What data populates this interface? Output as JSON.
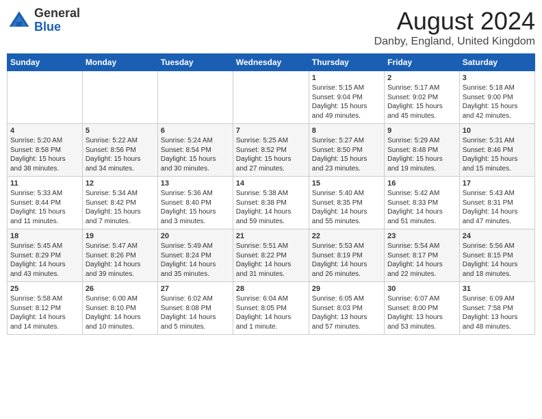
{
  "logo": {
    "general": "General",
    "blue": "Blue"
  },
  "header": {
    "month_year": "August 2024",
    "location": "Danby, England, United Kingdom"
  },
  "days_of_week": [
    "Sunday",
    "Monday",
    "Tuesday",
    "Wednesday",
    "Thursday",
    "Friday",
    "Saturday"
  ],
  "weeks": [
    [
      {
        "day": "",
        "info": ""
      },
      {
        "day": "",
        "info": ""
      },
      {
        "day": "",
        "info": ""
      },
      {
        "day": "",
        "info": ""
      },
      {
        "day": "1",
        "info": "Sunrise: 5:15 AM\nSunset: 9:04 PM\nDaylight: 15 hours\nand 49 minutes."
      },
      {
        "day": "2",
        "info": "Sunrise: 5:17 AM\nSunset: 9:02 PM\nDaylight: 15 hours\nand 45 minutes."
      },
      {
        "day": "3",
        "info": "Sunrise: 5:18 AM\nSunset: 9:00 PM\nDaylight: 15 hours\nand 42 minutes."
      }
    ],
    [
      {
        "day": "4",
        "info": "Sunrise: 5:20 AM\nSunset: 8:58 PM\nDaylight: 15 hours\nand 38 minutes."
      },
      {
        "day": "5",
        "info": "Sunrise: 5:22 AM\nSunset: 8:56 PM\nDaylight: 15 hours\nand 34 minutes."
      },
      {
        "day": "6",
        "info": "Sunrise: 5:24 AM\nSunset: 8:54 PM\nDaylight: 15 hours\nand 30 minutes."
      },
      {
        "day": "7",
        "info": "Sunrise: 5:25 AM\nSunset: 8:52 PM\nDaylight: 15 hours\nand 27 minutes."
      },
      {
        "day": "8",
        "info": "Sunrise: 5:27 AM\nSunset: 8:50 PM\nDaylight: 15 hours\nand 23 minutes."
      },
      {
        "day": "9",
        "info": "Sunrise: 5:29 AM\nSunset: 8:48 PM\nDaylight: 15 hours\nand 19 minutes."
      },
      {
        "day": "10",
        "info": "Sunrise: 5:31 AM\nSunset: 8:46 PM\nDaylight: 15 hours\nand 15 minutes."
      }
    ],
    [
      {
        "day": "11",
        "info": "Sunrise: 5:33 AM\nSunset: 8:44 PM\nDaylight: 15 hours\nand 11 minutes."
      },
      {
        "day": "12",
        "info": "Sunrise: 5:34 AM\nSunset: 8:42 PM\nDaylight: 15 hours\nand 7 minutes."
      },
      {
        "day": "13",
        "info": "Sunrise: 5:36 AM\nSunset: 8:40 PM\nDaylight: 15 hours\nand 3 minutes."
      },
      {
        "day": "14",
        "info": "Sunrise: 5:38 AM\nSunset: 8:38 PM\nDaylight: 14 hours\nand 59 minutes."
      },
      {
        "day": "15",
        "info": "Sunrise: 5:40 AM\nSunset: 8:35 PM\nDaylight: 14 hours\nand 55 minutes."
      },
      {
        "day": "16",
        "info": "Sunrise: 5:42 AM\nSunset: 8:33 PM\nDaylight: 14 hours\nand 51 minutes."
      },
      {
        "day": "17",
        "info": "Sunrise: 5:43 AM\nSunset: 8:31 PM\nDaylight: 14 hours\nand 47 minutes."
      }
    ],
    [
      {
        "day": "18",
        "info": "Sunrise: 5:45 AM\nSunset: 8:29 PM\nDaylight: 14 hours\nand 43 minutes."
      },
      {
        "day": "19",
        "info": "Sunrise: 5:47 AM\nSunset: 8:26 PM\nDaylight: 14 hours\nand 39 minutes."
      },
      {
        "day": "20",
        "info": "Sunrise: 5:49 AM\nSunset: 8:24 PM\nDaylight: 14 hours\nand 35 minutes."
      },
      {
        "day": "21",
        "info": "Sunrise: 5:51 AM\nSunset: 8:22 PM\nDaylight: 14 hours\nand 31 minutes."
      },
      {
        "day": "22",
        "info": "Sunrise: 5:53 AM\nSunset: 8:19 PM\nDaylight: 14 hours\nand 26 minutes."
      },
      {
        "day": "23",
        "info": "Sunrise: 5:54 AM\nSunset: 8:17 PM\nDaylight: 14 hours\nand 22 minutes."
      },
      {
        "day": "24",
        "info": "Sunrise: 5:56 AM\nSunset: 8:15 PM\nDaylight: 14 hours\nand 18 minutes."
      }
    ],
    [
      {
        "day": "25",
        "info": "Sunrise: 5:58 AM\nSunset: 8:12 PM\nDaylight: 14 hours\nand 14 minutes."
      },
      {
        "day": "26",
        "info": "Sunrise: 6:00 AM\nSunset: 8:10 PM\nDaylight: 14 hours\nand 10 minutes."
      },
      {
        "day": "27",
        "info": "Sunrise: 6:02 AM\nSunset: 8:08 PM\nDaylight: 14 hours\nand 5 minutes."
      },
      {
        "day": "28",
        "info": "Sunrise: 6:04 AM\nSunset: 8:05 PM\nDaylight: 14 hours\nand 1 minute."
      },
      {
        "day": "29",
        "info": "Sunrise: 6:05 AM\nSunset: 8:03 PM\nDaylight: 13 hours\nand 57 minutes."
      },
      {
        "day": "30",
        "info": "Sunrise: 6:07 AM\nSunset: 8:00 PM\nDaylight: 13 hours\nand 53 minutes."
      },
      {
        "day": "31",
        "info": "Sunrise: 6:09 AM\nSunset: 7:58 PM\nDaylight: 13 hours\nand 48 minutes."
      }
    ]
  ]
}
